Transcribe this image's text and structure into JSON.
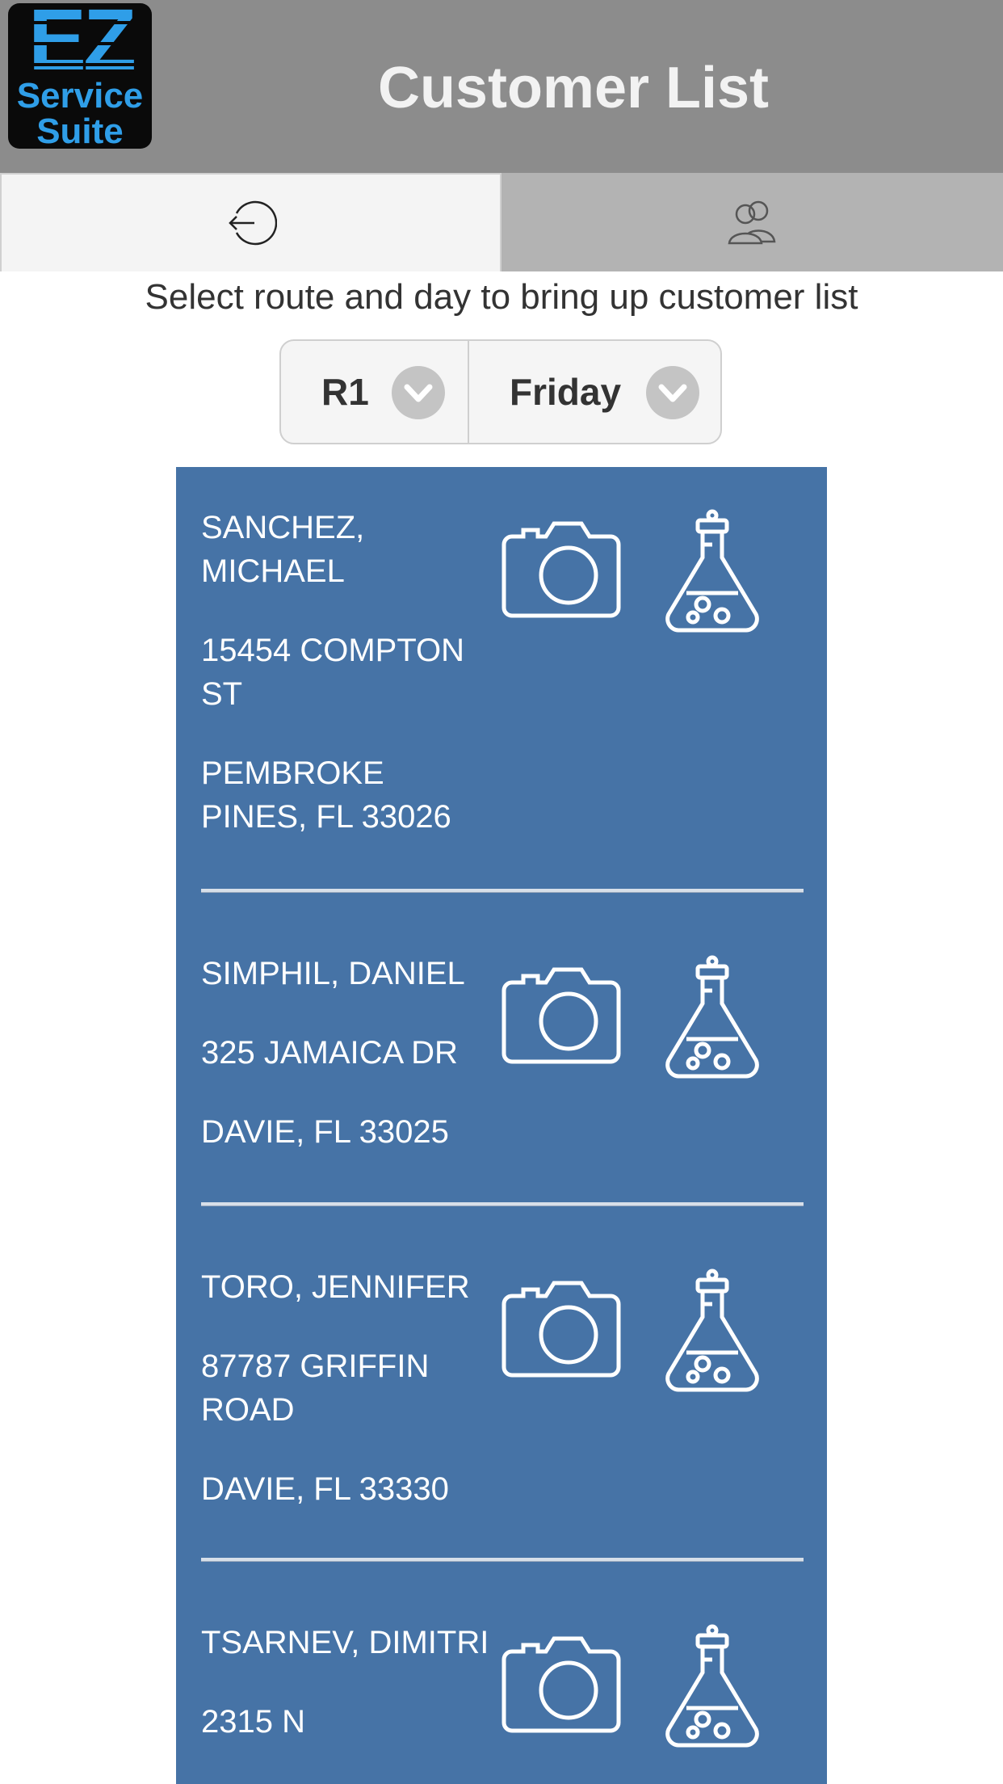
{
  "app": {
    "logo": {
      "line1": "EZ",
      "line2": "Service",
      "line3": "Suite"
    },
    "title": "Customer List"
  },
  "tabs": [
    {
      "icon": "logout-arrow-icon",
      "active": true
    },
    {
      "icon": "users-icon",
      "active": false
    }
  ],
  "instructions": "Select route and day to bring up customer list",
  "selectors": {
    "route": "R1",
    "day": "Friday"
  },
  "colors": {
    "header": "#8c8c8c",
    "list_background": "#4673a6",
    "text_on_list": "#ffffff"
  },
  "customers": [
    {
      "name": "SANCHEZ, MICHAEL",
      "street": "15454 COMPTON ST",
      "city": "PEMBROKE PINES, FL 33026"
    },
    {
      "name": "SIMPHIL, DANIEL",
      "street": "325 JAMAICA DR",
      "city": "DAVIE, FL 33025"
    },
    {
      "name": "TORO, JENNIFER",
      "street": "87787 GRIFFIN ROAD",
      "city": "DAVIE, FL 33330"
    },
    {
      "name": "TSARNEV, DIMITRI",
      "street": "2315 N",
      "city": ""
    }
  ]
}
